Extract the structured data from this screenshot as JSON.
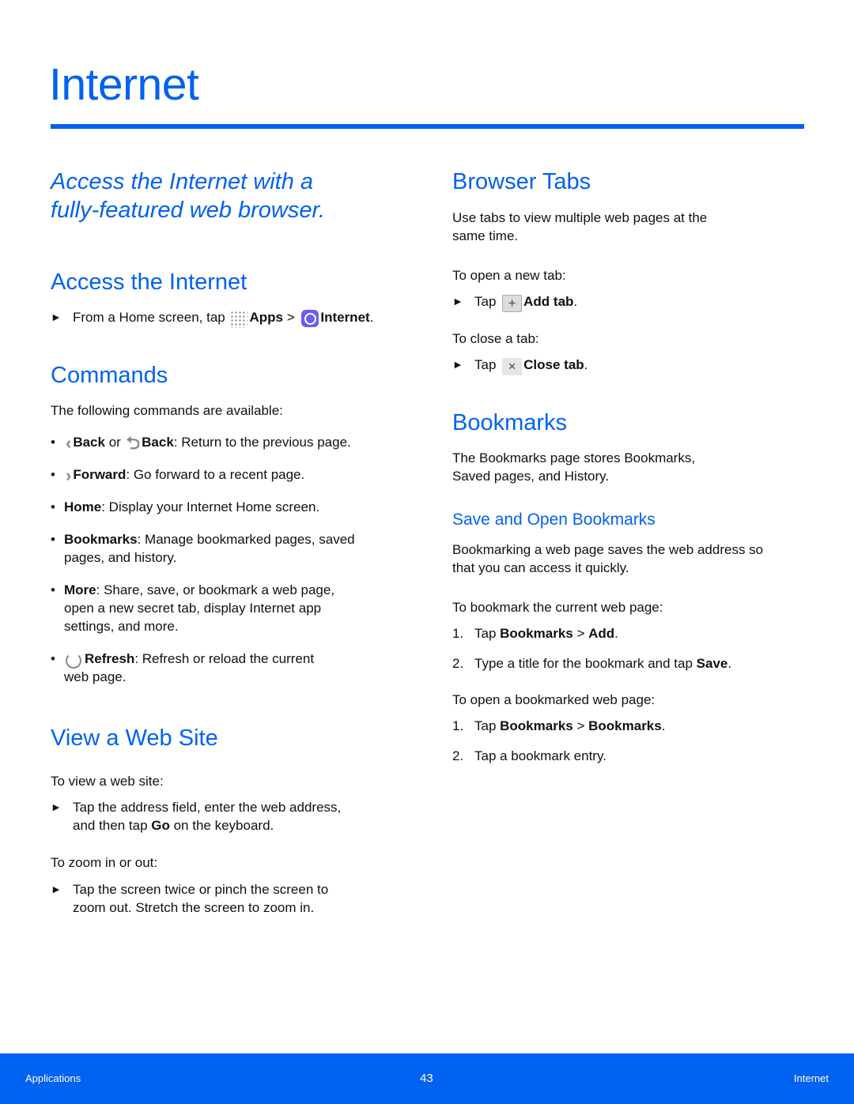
{
  "page_title": "Internet",
  "left": {
    "tagline_line1": "Access the Internet with a",
    "tagline_line2": "fully-featured web browser.",
    "access": {
      "heading": "Access the Internet",
      "step_prefix": "From a Home screen, tap ",
      "apps_label": "Apps",
      "separator": " > ",
      "internet_label": "Internet",
      "step_suffix": "."
    },
    "commands": {
      "heading": "Commands",
      "intro": "The following commands are available:",
      "items": [
        {
          "icon": "chevron-left-icon",
          "label": "Back",
          "mid": " or ",
          "icon2": "return-arrow-icon",
          "label2": "Back",
          "text": ": Return to the previous page."
        },
        {
          "icon": "chevron-right-icon",
          "label": "Forward",
          "text": ": Go forward to a recent page."
        },
        {
          "label": "Home",
          "text": ": Display your Internet Home screen."
        },
        {
          "label": "Bookmarks",
          "text": ": Manage bookmarked pages, saved",
          "text2": "pages, and history."
        },
        {
          "label": "More",
          "text": ": Share, save, or bookmark a web page,",
          "text2": "open a new secret tab, display Internet app",
          "text3": "settings, and more."
        },
        {
          "icon": "refresh-icon",
          "label": "Refresh",
          "text": ": Refresh or reload the current",
          "text2": "web page."
        }
      ]
    },
    "view_site": {
      "heading": "View a Web Site",
      "intro": "To view a web site:",
      "step1_line1": "Tap the address field, enter the web address,",
      "step1_line2_pre": "and then tap ",
      "step1_bold": "Go",
      "step1_line2_post": " on the keyboard.",
      "zoom_intro": "To zoom in or out:",
      "step2_line1": "Tap the screen twice or pinch the screen to",
      "step2_line2": "zoom out. Stretch the screen to zoom in."
    }
  },
  "right": {
    "browser_tabs": {
      "heading": "Browser Tabs",
      "desc_line1": "Use tabs to view multiple web pages at the",
      "desc_line2": "same time.",
      "open_intro": "To open a new tab:",
      "tap": "Tap ",
      "add_icon": "+",
      "add_label": "Add tab",
      "close_intro": "To close a tab:",
      "close_icon": "×",
      "close_label": "Close tab",
      "period": "."
    },
    "bookmarks": {
      "heading": "Bookmarks",
      "desc_line1": "The Bookmarks page stores Bookmarks,",
      "desc_line2": "Saved pages, and History.",
      "sub_heading": "Save and Open Bookmarks",
      "sub_desc_line1": "Bookmarking a web page saves the web address so",
      "sub_desc_line2": "that you can access it quickly.",
      "save_intro": "To bookmark the current web page:",
      "save_steps": [
        {
          "n": "1.",
          "pre": "Tap ",
          "b1": "Bookmarks",
          "mid": " > ",
          "b2": "Add",
          "post": "."
        },
        {
          "n": "2.",
          "pre": "Type a title for the bookmark and tap ",
          "b1": "Save",
          "post": "."
        }
      ],
      "open_intro": "To open a bookmarked web page:",
      "open_steps": [
        {
          "n": "1.",
          "pre": "Tap ",
          "b1": "Bookmarks",
          "mid": " > ",
          "b2": "Bookmarks",
          "post": "."
        },
        {
          "n": "2.",
          "pre": "Tap a bookmark entry."
        }
      ]
    }
  },
  "footer": {
    "section": "Applications",
    "page_number": "43",
    "chapter": "Internet"
  },
  "arrow_glyph": "►",
  "bullet_glyph": "•"
}
